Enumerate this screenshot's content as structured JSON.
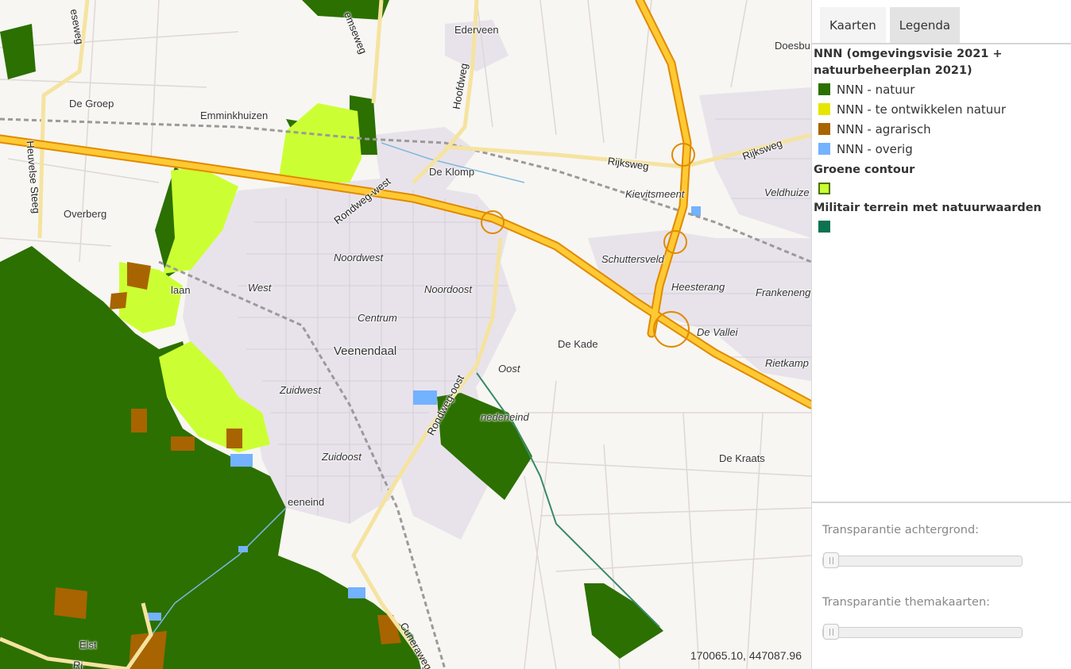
{
  "tabs": [
    {
      "label": "Kaarten",
      "active": false
    },
    {
      "label": "Legenda",
      "active": true
    }
  ],
  "legend": {
    "groups": [
      {
        "title": "NNN (omgevingsvisie 2021 + natuurbeheerplan 2021)",
        "items": [
          {
            "label": "NNN - natuur",
            "color": "#2b7000"
          },
          {
            "label": "NNN - te ontwikkelen natuur",
            "color": "#e6e600"
          },
          {
            "label": "NNN - agrarisch",
            "color": "#a86400"
          },
          {
            "label": "NNN - overig",
            "color": "#73b2ff"
          }
        ]
      },
      {
        "title": "Groene contour",
        "items": [
          {
            "label": "",
            "color": "#ccff33",
            "border": "#4c7300"
          }
        ]
      },
      {
        "title": "Militair terrein met natuurwaarden",
        "items": [
          {
            "label": "",
            "color": "#0b7350"
          }
        ]
      }
    ]
  },
  "sliders": {
    "background_label": "Transparantie achtergrond:",
    "background_value": 0,
    "theme_label": "Transparantie themakaarten:",
    "theme_value": 0
  },
  "map": {
    "coordinates": "170065.10, 447087.96",
    "places": {
      "ederveen": "Ederveen",
      "doesburg": "Doesbu",
      "de_groep": "De Groep",
      "emminkhuizen": "Emminkhuizen",
      "de_klomp": "De Klomp",
      "overberg": "Overberg",
      "kievitsmeent": "Kievitsmeent",
      "veldhuizen": "Veldhuize",
      "schuttersveld": "Schuttersveld",
      "heesterang": "Heesterang",
      "frankeneng": "Frankeneng",
      "noordwest": "Noordwest",
      "noordoost": "Noordoost",
      "west": "West",
      "centrum": "Centrum",
      "veenendaal": "Veenendaal",
      "de_vallei": "De Vallei",
      "de_kade": "De Kade",
      "rietkamp": "Rietkamp",
      "oost": "Oost",
      "zuidwest": "Zuidwest",
      "veenendaal_oost": "nedeneind",
      "zuidoost": "Zuidoost",
      "de_kraats": "De Kraats",
      "veeneind": "eeneind",
      "elst": "Elst",
      "ijzervaart": "laan"
    },
    "roads": {
      "dieseweg": "eseweg",
      "remmseweg": "emseweg",
      "hoofdweg": "Hoofdweg",
      "heuvelse_steeg": "Heuvelse Steeg",
      "rijksweg_1": "Rijksweg",
      "rijksweg_2": "Rijksweg",
      "rondweg_west": "Rondweg-west",
      "rondweg_oost": "Rondweg-oost",
      "cuneraweg": "Cuneraweg",
      "ri": "Ri"
    }
  }
}
